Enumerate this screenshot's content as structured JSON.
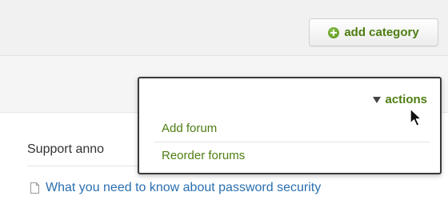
{
  "header": {
    "add_category_label": "add category",
    "add_icon": "plus-circle-icon"
  },
  "dropdown": {
    "toggle_label": "actions",
    "toggle_icon": "triangle-down-icon",
    "items": [
      {
        "label": "Add forum"
      },
      {
        "label": "Reorder forums"
      }
    ]
  },
  "section": {
    "title": "Support anno"
  },
  "topics": [
    {
      "label": "What you need to know about password security",
      "icon": "document-icon"
    }
  ],
  "colors": {
    "accent_green": "#4e7d12",
    "link_blue": "#2a6fb0"
  }
}
